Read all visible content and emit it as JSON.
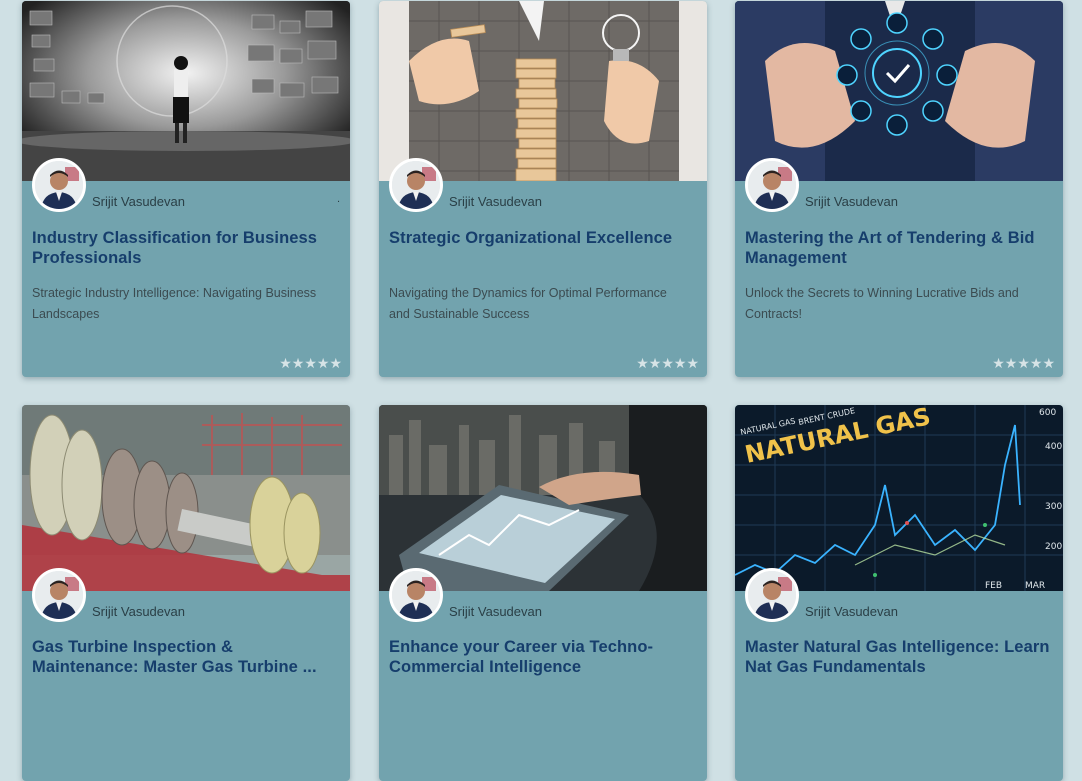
{
  "cards": [
    {
      "author": "Srijit Vasudevan",
      "title": "Industry Classification for Business Professionals",
      "description": "Strategic Industry Intelligence: Navigating Business Landscapes",
      "extra_mark": ".",
      "rating_stars": "★★★★★",
      "image_icon": "futuristic-data-screens-image"
    },
    {
      "author": "Srijit Vasudevan",
      "title": "Strategic Organizational Excellence",
      "description": "Navigating the Dynamics for Optimal Performance and Sustainable Success",
      "rating_stars": "★★★★★",
      "image_icon": "jenga-tower-lightbulb-image"
    },
    {
      "author": "Srijit Vasudevan",
      "title": "Mastering the Art of Tendering & Bid Management",
      "description": "Unlock the Secrets to Winning Lucrative Bids and Contracts!",
      "rating_stars": "★★★★★",
      "image_icon": "network-icons-hands-image"
    },
    {
      "author": "Srijit Vasudevan",
      "title": "Gas Turbine Inspection & Maintenance: Master Gas Turbine ...",
      "image_icon": "gas-turbine-rotor-image"
    },
    {
      "author": "Srijit Vasudevan",
      "title": "Enhance your Career via Techno-Commercial Intelligence",
      "image_icon": "tablet-city-image"
    },
    {
      "author": "Srijit Vasudevan",
      "title": "Master Natural Gas Intelligence: Learn Nat Gas Fundamentals",
      "image_icon": "natural-gas-chart-image",
      "image_text": {
        "headline": "NATURAL GAS",
        "top_left": "NATURAL GAS",
        "top_mid": "BRENT CRUDE",
        "axis_600": "600",
        "axis_400": "400",
        "axis_300": "300",
        "axis_200": "200",
        "month_feb": "FEB",
        "month_mar": "MAR"
      }
    }
  ],
  "colors": {
    "page_bg": "#cfe0e4",
    "card_bg": "#72a3ae",
    "title": "#163e6c",
    "text": "#3b4b50"
  }
}
